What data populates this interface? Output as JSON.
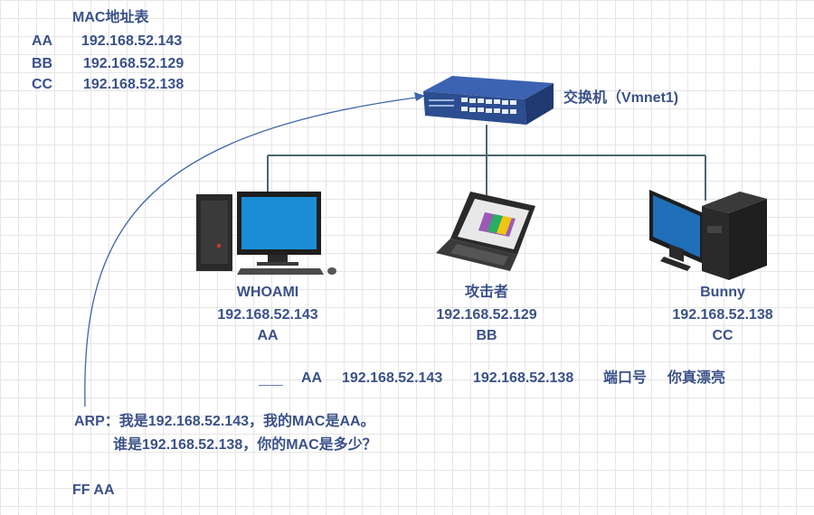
{
  "mac_table": {
    "title": "MAC地址表",
    "rows": [
      {
        "name": "AA",
        "ip": "192.168.52.143"
      },
      {
        "name": "BB",
        "ip": "192.168.52.129"
      },
      {
        "name": "CC",
        "ip": "192.168.52.138"
      }
    ]
  },
  "switch": {
    "label": "交换机（Vmnet1)"
  },
  "hosts": [
    {
      "name": "WHOAMI",
      "ip": "192.168.52.143",
      "mac": "AA"
    },
    {
      "name": "攻击者",
      "ip": "192.168.52.129",
      "mac": "BB"
    },
    {
      "name": "Bunny",
      "ip": "192.168.52.138",
      "mac": "CC"
    }
  ],
  "packet": {
    "prefix": "___",
    "src_mac": "AA",
    "src_ip": "192.168.52.143",
    "dst_ip": "192.168.52.138",
    "port": "端口号",
    "payload": "你真漂亮"
  },
  "arp": {
    "line1": "ARP：我是192.168.52.143，我的MAC是AA。",
    "line2": "谁是192.168.52.138，你的MAC是多少？",
    "reply": "FF AA"
  },
  "colors": {
    "text": "#3a5189",
    "link": "#4a6670",
    "arrow": "#3f66a8",
    "switch_body": "#2c4d8f"
  }
}
